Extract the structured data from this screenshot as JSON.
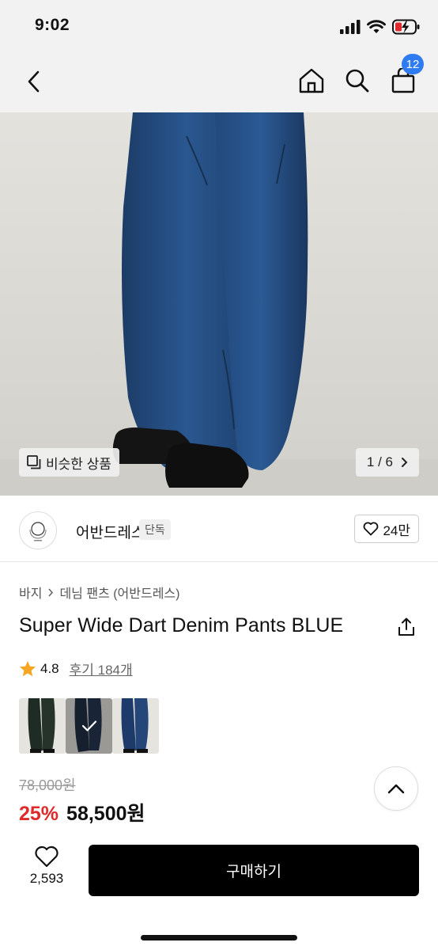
{
  "status_bar": {
    "time": "9:02",
    "battery_color": "#e0292a"
  },
  "nav": {
    "back_icon": "chevron-left-icon",
    "home_icon": "home-icon",
    "search_icon": "search-icon",
    "cart_icon": "shopping-bag-icon",
    "cart_count": "12",
    "badge_color": "#2f7bf2"
  },
  "hero": {
    "similar_label": "비슷한 상품",
    "counter": "1 / 6"
  },
  "brand": {
    "name": "어반드레스",
    "badge": "단독",
    "likes": "24만"
  },
  "product": {
    "breadcrumb": [
      "바지",
      "데님 팬츠 (어반드레스)"
    ],
    "title": "Super Wide Dart Denim Pants BLUE",
    "rating": "4.8",
    "reviews": "후기 184개"
  },
  "thumbnails": [
    {
      "color": "#1f2c25",
      "selected": false
    },
    {
      "color": "#1d2a3e",
      "selected": true
    },
    {
      "color": "#1e3a6a",
      "selected": false
    }
  ],
  "price": {
    "original": "78,000원",
    "discount": "25%",
    "sale": "58,500원"
  },
  "bottom_bar": {
    "wish_count": "2,593",
    "buy_label": "구매하기"
  },
  "colors": {
    "accent": "#2f7bf2",
    "discount": "#e0292a",
    "star": "#f5a623"
  }
}
